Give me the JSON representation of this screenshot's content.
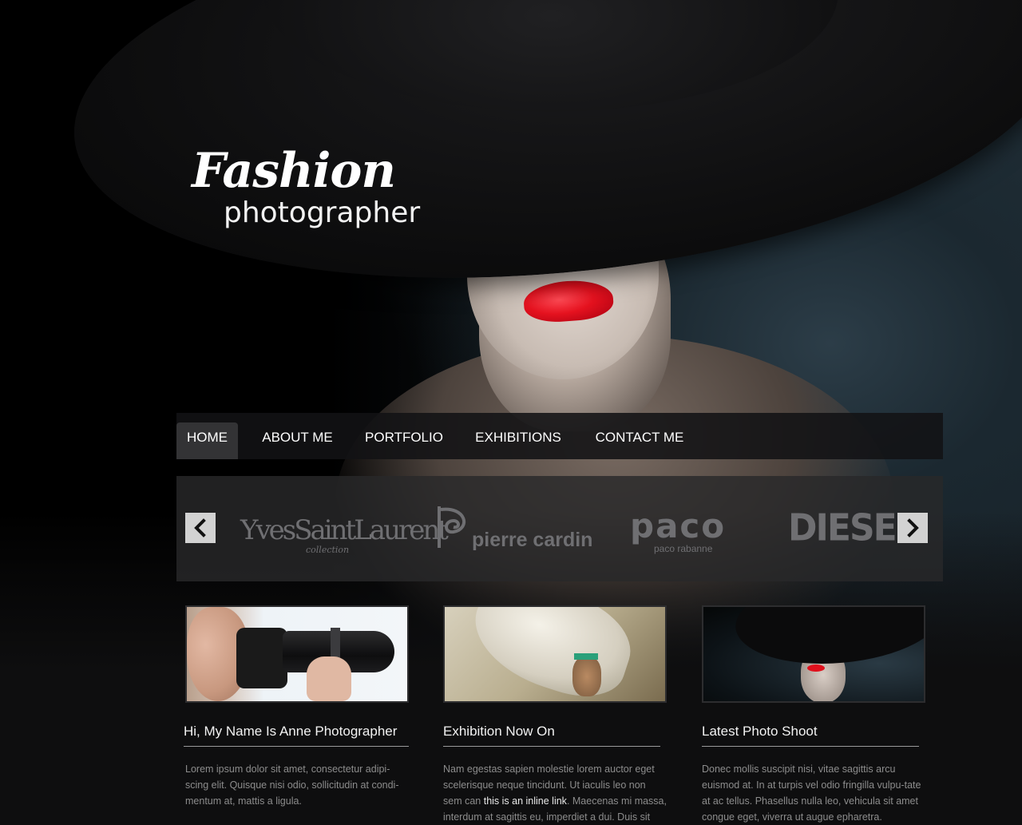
{
  "logo": {
    "main": "Fashion",
    "sub": "photographer"
  },
  "nav": {
    "items": [
      {
        "label": "HOME",
        "active": true
      },
      {
        "label": "ABOUT ME",
        "active": false
      },
      {
        "label": "PORTFOLIO",
        "active": false
      },
      {
        "label": "EXHIBITIONS",
        "active": false
      },
      {
        "label": "CONTACT ME",
        "active": false
      }
    ]
  },
  "brands": {
    "ysl": "YvesSaintLaurent",
    "ysl_sub": "collection",
    "cardin": "pierre cardin",
    "paco": "paco",
    "paco_sub": "paco rabanne",
    "diesel": "DIESEL",
    "prev_icon": "chevron-left-icon",
    "next_icon": "chevron-right-icon"
  },
  "columns": [
    {
      "title": "Hi, My Name Is Anne Photographer",
      "body": "Lorem ipsum dolor sit amet, consectetur adipi-scing elit. Quisque nisi odio, sollicitudin at condi-mentum at, mattis a ligula."
    },
    {
      "title": "Exhibition Now On",
      "body_before": "Nam egestas sapien molestie lorem auctor eget scelerisque neque tincidunt. Ut iaculis leo non sem can ",
      "link": "this is an inline link",
      "body_after": ". Maecenas mi massa, interdum at sagittis eu, imperdiet a dui. Duis sit"
    },
    {
      "title": "Latest Photo Shoot",
      "body": "Donec mollis suscipit nisi, vitae sagittis arcu euismod at. In at turpis vel odio fringilla vulpu-tate at ac tellus. Phasellus nulla leo, vehicula sit amet congue eget, viverra ut augue epharetra."
    }
  ],
  "colors": {
    "background": "#0e0e0f",
    "nav_bar": "#121214",
    "nav_active": "#333335",
    "carousel": "#28282a",
    "lips_red": "#e5121f",
    "text_muted": "#8c8c8c"
  }
}
